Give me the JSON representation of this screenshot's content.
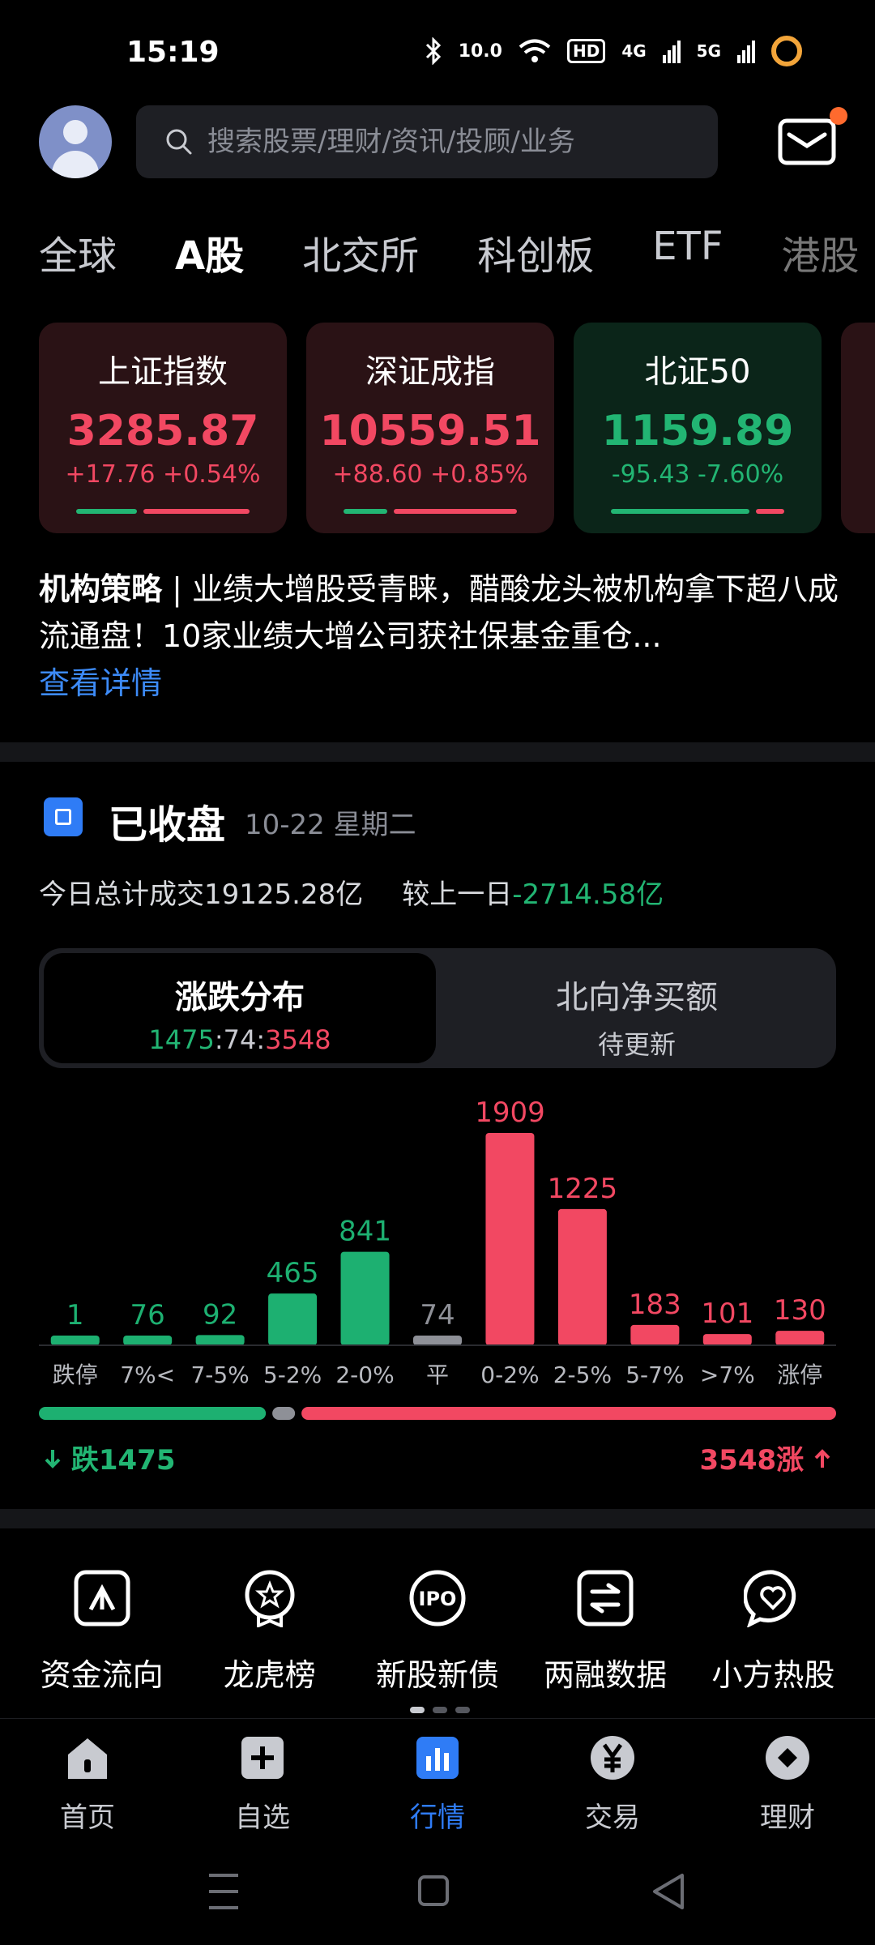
{
  "status_bar": {
    "time": "15:19",
    "net_speed": "10.0",
    "hd": "HD",
    "sig1": "4G",
    "sig2": "5G"
  },
  "search": {
    "placeholder": "搜索股票/理财/资讯/投顾/业务"
  },
  "tabs": [
    "全球",
    "A股",
    "北交所",
    "科创板",
    "ETF",
    "港股"
  ],
  "active_tab": "A股",
  "indices": [
    {
      "name": "上证指数",
      "value": "3285.87",
      "change": "+17.76 +0.54%",
      "trend": "up",
      "down_fraction": 0.35
    },
    {
      "name": "深证成指",
      "value": "10559.51",
      "change": "+88.60 +0.85%",
      "trend": "up",
      "down_fraction": 0.25
    },
    {
      "name": "北证50",
      "value": "1159.89",
      "change": "-95.43 -7.60%",
      "trend": "down",
      "down_fraction": 0.8
    }
  ],
  "news": {
    "tag": "机构策略",
    "text": " | 业绩大增股受青睐，醋酸龙头被机构拿下超八成流通盘！10家业绩大增公司获社保基金重仓...",
    "link": "查看详情"
  },
  "market": {
    "status": "已收盘",
    "date": "10-22 星期二",
    "volume_label": "今日总计成交19125.28亿",
    "compare_label": "较上一日",
    "compare_value": "-2714.58亿"
  },
  "segments": {
    "a_title": "涨跌分布",
    "a_down": "1475",
    "a_flat": "74",
    "a_up": "3548",
    "b_title": "北向净买额",
    "b_sub": "待更新"
  },
  "chart_data": {
    "type": "bar",
    "categories": [
      "跌停",
      "7%<",
      "7-5%",
      "5-2%",
      "2-0%",
      "平",
      "0-2%",
      "2-5%",
      "5-7%",
      ">7%",
      "涨停"
    ],
    "values": [
      1,
      76,
      92,
      465,
      841,
      74,
      1909,
      1225,
      183,
      101,
      130
    ],
    "groups": [
      "down",
      "down",
      "down",
      "down",
      "down",
      "flat",
      "up",
      "up",
      "up",
      "up",
      "up"
    ],
    "title": "",
    "xlabel": "",
    "ylabel": "",
    "ylim": [
      0,
      1909
    ],
    "grid": false,
    "colors": {
      "down": "#1db071",
      "flat": "#8e9097",
      "up": "#f24862"
    }
  },
  "totals": {
    "down_label": "跌1475",
    "up_label": "3548涨",
    "down": 1475,
    "flat": 74,
    "up": 3548
  },
  "shortcuts": [
    "资金流向",
    "龙虎榜",
    "新股新债",
    "两融数据",
    "小方热股"
  ],
  "nav": [
    {
      "label": "首页",
      "icon": "home-icon"
    },
    {
      "label": "自选",
      "icon": "plus-icon"
    },
    {
      "label": "行情",
      "icon": "chart-icon"
    },
    {
      "label": "交易",
      "icon": "yen-icon"
    },
    {
      "label": "理财",
      "icon": "diamond-icon"
    }
  ],
  "active_nav": "行情",
  "colors": {
    "up": "#f24862",
    "down": "#22b573",
    "accent": "#2f7cf6"
  }
}
